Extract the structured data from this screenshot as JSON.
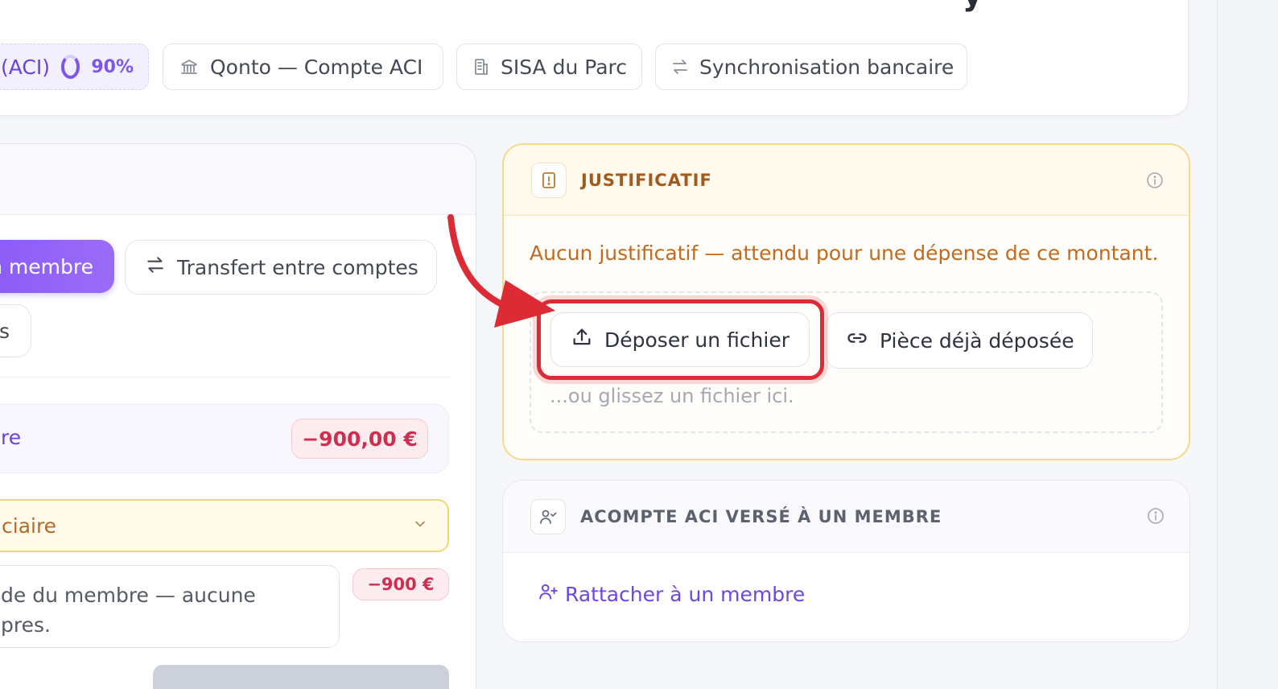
{
  "header": {
    "title_fragment": "y",
    "chips": [
      {
        "label": "(ACI)",
        "percent": "90%",
        "icon": "progress-ring-icon"
      },
      {
        "label": "Qonto — Compte ACI",
        "icon": "bank-icon"
      },
      {
        "label": "SISA du Parc",
        "icon": "building-icon"
      },
      {
        "label": "Synchronisation bancaire",
        "icon": "sync-arrows-icon"
      }
    ]
  },
  "left_panel": {
    "pill_member": "n membre",
    "pill_transfer": "Transfert entre comptes",
    "pill_third": "s",
    "amount_row_label": "re",
    "amount_badge": "−900,00 €",
    "select_label": "ciaire",
    "note_lines": [
      "de du membre — aucune",
      "pres."
    ],
    "small_badge": "−900 €"
  },
  "justificatif": {
    "title": "JUSTIFICATIF",
    "message": "Aucun justificatif — attendu pour une dépense de ce montant.",
    "upload_button": "Déposer un fichier",
    "existing_button": "Pièce déjà déposée",
    "drop_hint": "...ou glissez un fichier ici."
  },
  "acompte": {
    "title": "ACOMPTE ACI VERSÉ À UN MEMBRE",
    "link": "Rattacher à un membre"
  },
  "colors": {
    "accent": "#8b5cf6",
    "warning": "#c26a1e",
    "danger": "#cf2e50",
    "annotation": "#dc2b35"
  }
}
